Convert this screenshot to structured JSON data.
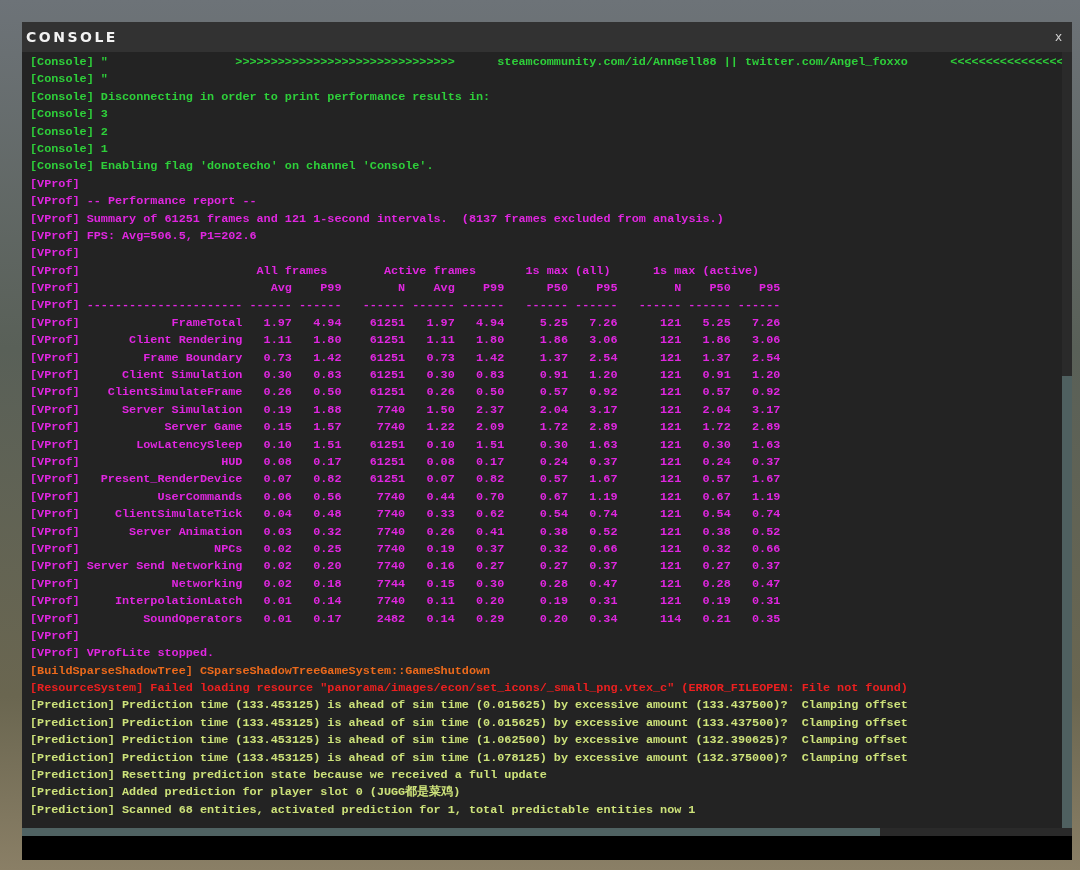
{
  "window": {
    "title": "CONSOLE",
    "close": "x"
  },
  "log": [
    {
      "kind": "text",
      "tag": "[Console]",
      "text": "\"                  >>>>>>>>>>>>>>>>>>>>>>>>>>>>>>>      steamcommunity.com/id/AnnGell88 || twitter.com/Angel_foxxo      <<<<<<<<<<<<<<<<",
      "color": "#2ed03a"
    },
    {
      "kind": "text",
      "tag": "[Console]",
      "text": "\"",
      "color": "#2ed03a"
    },
    {
      "kind": "text",
      "tag": "[Console]",
      "text": "Disconnecting in order to print performance results in:",
      "color": "#2ed03a"
    },
    {
      "kind": "text",
      "tag": "[Console]",
      "text": "3",
      "color": "#2ed03a"
    },
    {
      "kind": "text",
      "tag": "[Console]",
      "text": "2",
      "color": "#2ed03a"
    },
    {
      "kind": "text",
      "tag": "[Console]",
      "text": "1",
      "color": "#2ed03a"
    },
    {
      "kind": "text",
      "tag": "[Console]",
      "text": "Enabling flag 'donotecho' on channel 'Console'.",
      "color": "#2ed03a"
    },
    {
      "kind": "text",
      "tag": "[VProf]",
      "color": "#e026e0"
    },
    {
      "kind": "text",
      "tag": "[VProf]",
      "text": "-- Performance report --",
      "color": "#e026e0"
    },
    {
      "kind": "text",
      "tag": "[VProf]",
      "text": "Summary of 61251 frames and 121 1-second intervals.  (8137 frames excluded from analysis.)",
      "color": "#e026e0"
    },
    {
      "kind": "text",
      "tag": "[VProf]",
      "text": "FPS: Avg=506.5, P1=202.6",
      "color": "#e026e0"
    },
    {
      "kind": "text",
      "tag": "[VProf]",
      "color": "#e026e0"
    },
    {
      "kind": "groups",
      "tag": "[VProf]",
      "groups": [
        "All frames",
        "Active frames",
        "1s max (all)",
        "1s max (active)"
      ],
      "color": "#e026e0"
    },
    {
      "kind": "cells",
      "tag": "[VProf]",
      "cells": [
        "",
        "Avg",
        "P99",
        "N",
        "Avg",
        "P99",
        "P50",
        "P95",
        "N",
        "P50",
        "P95"
      ],
      "color": "#e026e0"
    },
    {
      "kind": "cells",
      "tag": "[VProf]",
      "cells": [
        "----------------------",
        "------",
        "------",
        "------",
        "------",
        "------",
        "------",
        "------",
        "------",
        "------",
        "------"
      ],
      "color": "#e026e0"
    },
    {
      "kind": "cells",
      "tag": "[VProf]",
      "cells": [
        "FrameTotal",
        "1.97",
        "4.94",
        "61251",
        "1.97",
        "4.94",
        "5.25",
        "7.26",
        "121",
        "5.25",
        "7.26"
      ],
      "color": "#e026e0"
    },
    {
      "kind": "cells",
      "tag": "[VProf]",
      "cells": [
        "Client Rendering",
        "1.11",
        "1.80",
        "61251",
        "1.11",
        "1.80",
        "1.86",
        "3.06",
        "121",
        "1.86",
        "3.06"
      ],
      "color": "#e026e0"
    },
    {
      "kind": "cells",
      "tag": "[VProf]",
      "cells": [
        "Frame Boundary",
        "0.73",
        "1.42",
        "61251",
        "0.73",
        "1.42",
        "1.37",
        "2.54",
        "121",
        "1.37",
        "2.54"
      ],
      "color": "#e026e0"
    },
    {
      "kind": "cells",
      "tag": "[VProf]",
      "cells": [
        "Client Simulation",
        "0.30",
        "0.83",
        "61251",
        "0.30",
        "0.83",
        "0.91",
        "1.20",
        "121",
        "0.91",
        "1.20"
      ],
      "color": "#e026e0"
    },
    {
      "kind": "cells",
      "tag": "[VProf]",
      "cells": [
        "ClientSimulateFrame",
        "0.26",
        "0.50",
        "61251",
        "0.26",
        "0.50",
        "0.57",
        "0.92",
        "121",
        "0.57",
        "0.92"
      ],
      "color": "#e026e0"
    },
    {
      "kind": "cells",
      "tag": "[VProf]",
      "cells": [
        "Server Simulation",
        "0.19",
        "1.88",
        "7740",
        "1.50",
        "2.37",
        "2.04",
        "3.17",
        "121",
        "2.04",
        "3.17"
      ],
      "color": "#e026e0"
    },
    {
      "kind": "cells",
      "tag": "[VProf]",
      "cells": [
        "Server Game",
        "0.15",
        "1.57",
        "7740",
        "1.22",
        "2.09",
        "1.72",
        "2.89",
        "121",
        "1.72",
        "2.89"
      ],
      "color": "#e026e0"
    },
    {
      "kind": "cells",
      "tag": "[VProf]",
      "cells": [
        "LowLatencySleep",
        "0.10",
        "1.51",
        "61251",
        "0.10",
        "1.51",
        "0.30",
        "1.63",
        "121",
        "0.30",
        "1.63"
      ],
      "color": "#e026e0"
    },
    {
      "kind": "cells",
      "tag": "[VProf]",
      "cells": [
        "HUD",
        "0.08",
        "0.17",
        "61251",
        "0.08",
        "0.17",
        "0.24",
        "0.37",
        "121",
        "0.24",
        "0.37"
      ],
      "color": "#e026e0"
    },
    {
      "kind": "cells",
      "tag": "[VProf]",
      "cells": [
        "Present_RenderDevice",
        "0.07",
        "0.82",
        "61251",
        "0.07",
        "0.82",
        "0.57",
        "1.67",
        "121",
        "0.57",
        "1.67"
      ],
      "color": "#e026e0"
    },
    {
      "kind": "cells",
      "tag": "[VProf]",
      "cells": [
        "UserCommands",
        "0.06",
        "0.56",
        "7740",
        "0.44",
        "0.70",
        "0.67",
        "1.19",
        "121",
        "0.67",
        "1.19"
      ],
      "color": "#e026e0"
    },
    {
      "kind": "cells",
      "tag": "[VProf]",
      "cells": [
        "ClientSimulateTick",
        "0.04",
        "0.48",
        "7740",
        "0.33",
        "0.62",
        "0.54",
        "0.74",
        "121",
        "0.54",
        "0.74"
      ],
      "color": "#e026e0"
    },
    {
      "kind": "cells",
      "tag": "[VProf]",
      "cells": [
        "Server Animation",
        "0.03",
        "0.32",
        "7740",
        "0.26",
        "0.41",
        "0.38",
        "0.52",
        "121",
        "0.38",
        "0.52"
      ],
      "color": "#e026e0"
    },
    {
      "kind": "cells",
      "tag": "[VProf]",
      "cells": [
        "NPCs",
        "0.02",
        "0.25",
        "7740",
        "0.19",
        "0.37",
        "0.32",
        "0.66",
        "121",
        "0.32",
        "0.66"
      ],
      "color": "#e026e0"
    },
    {
      "kind": "cells",
      "tag": "[VProf]",
      "cells": [
        "Server Send Networking",
        "0.02",
        "0.20",
        "7740",
        "0.16",
        "0.27",
        "0.27",
        "0.37",
        "121",
        "0.27",
        "0.37"
      ],
      "color": "#e026e0"
    },
    {
      "kind": "cells",
      "tag": "[VProf]",
      "cells": [
        "Networking",
        "0.02",
        "0.18",
        "7744",
        "0.15",
        "0.30",
        "0.28",
        "0.47",
        "121",
        "0.28",
        "0.47"
      ],
      "color": "#e026e0"
    },
    {
      "kind": "cells",
      "tag": "[VProf]",
      "cells": [
        "InterpolationLatch",
        "0.01",
        "0.14",
        "7740",
        "0.11",
        "0.20",
        "0.19",
        "0.31",
        "121",
        "0.19",
        "0.31"
      ],
      "color": "#e026e0"
    },
    {
      "kind": "cells",
      "tag": "[VProf]",
      "cells": [
        "SoundOperators",
        "0.01",
        "0.17",
        "2482",
        "0.14",
        "0.29",
        "0.20",
        "0.34",
        "114",
        "0.21",
        "0.35"
      ],
      "color": "#e026e0"
    },
    {
      "kind": "text",
      "tag": "[VProf]",
      "color": "#e026e0"
    },
    {
      "kind": "text",
      "tag": "[VProf]",
      "text": "VProfLite stopped.",
      "color": "#e026e0"
    },
    {
      "kind": "text",
      "tag": "[BuildSparseShadowTree]",
      "text": "CSparseShadowTreeGameSystem::GameShutdown",
      "color": "#ec6a1c"
    },
    {
      "kind": "text",
      "tag": "[ResourceSystem]",
      "text": "Failed loading resource \"panorama/images/econ/set_icons/_small_png.vtex_c\" (ERROR_FILEOPEN: File not found)",
      "color": "#ec2020"
    },
    {
      "kind": "text",
      "tag": "[Prediction]",
      "text": "Prediction time (133.453125) is ahead of sim time (0.015625) by excessive amount (133.437500)?  Clamping offset",
      "color": "#cde27a"
    },
    {
      "kind": "text",
      "tag": "[Prediction]",
      "text": "Prediction time (133.453125) is ahead of sim time (0.015625) by excessive amount (133.437500)?  Clamping offset",
      "color": "#cde27a"
    },
    {
      "kind": "text",
      "tag": "[Prediction]",
      "text": "Prediction time (133.453125) is ahead of sim time (1.062500) by excessive amount (132.390625)?  Clamping offset",
      "color": "#cde27a"
    },
    {
      "kind": "text",
      "tag": "[Prediction]",
      "text": "Prediction time (133.453125) is ahead of sim time (1.078125) by excessive amount (132.375000)?  Clamping offset",
      "color": "#cde27a"
    },
    {
      "kind": "text",
      "tag": "[Prediction]",
      "text": "Resetting prediction state because we received a full update",
      "color": "#cde27a"
    },
    {
      "kind": "text",
      "tag": "[Prediction]",
      "text": "Added prediction for player slot 0 (JUGG都是菜鸡)",
      "color": "#cde27a"
    },
    {
      "kind": "text",
      "tag": "[Prediction]",
      "text": "Scanned 68 entities, activated prediction for 1, total predictable entities now 1",
      "color": "#cde27a"
    }
  ]
}
